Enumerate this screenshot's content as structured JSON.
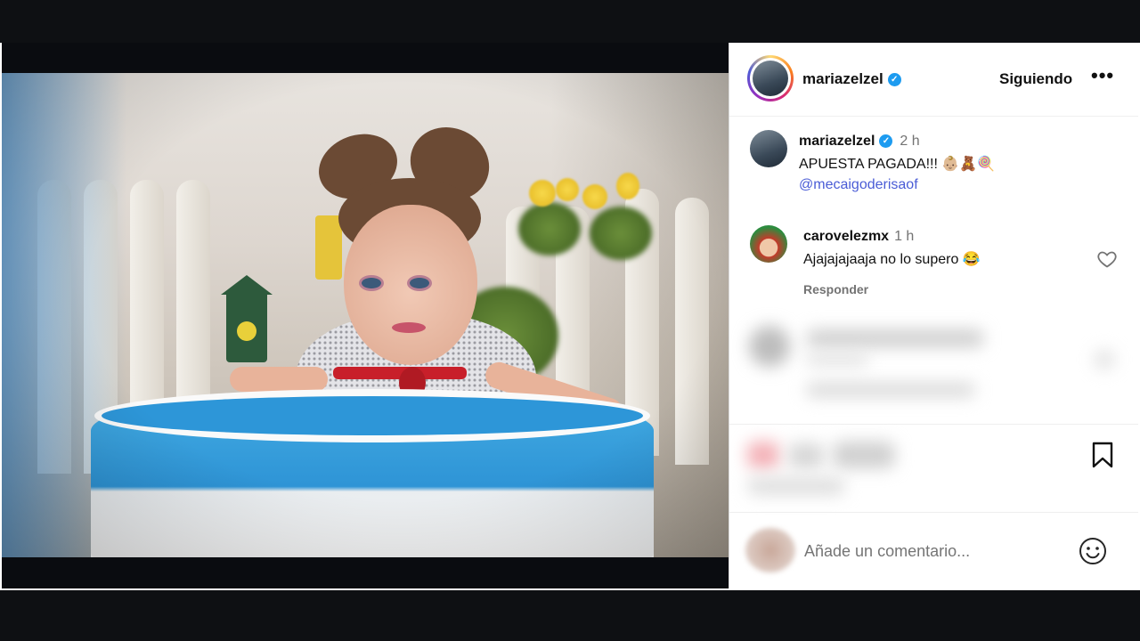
{
  "post": {
    "author": {
      "username": "mariazelzel",
      "verified": true,
      "follow_label": "Siguiendo",
      "more_icon": "ellipsis-icon",
      "more_label": "•••"
    },
    "caption": {
      "username": "mariazelzel",
      "time": "2 h",
      "text": "APUESTA PAGADA!!! 👶🏼🧸🍭",
      "mention": "@mecaigoderisaof"
    },
    "comments": [
      {
        "username": "carovelezmx",
        "time": "1 h",
        "text": "Ajajajajaaja no lo supero 😂",
        "reply_label": "Responder"
      }
    ],
    "add_comment": {
      "placeholder": "Añade un comentario...",
      "emoji_icon": "smiley-icon"
    },
    "icons": {
      "verified": "verified-badge-icon",
      "heart": "heart-icon",
      "bookmark": "bookmark-icon"
    },
    "colors": {
      "verified": "#1d9bf0",
      "mention": "#4a5cd6",
      "secondary_text": "#737373"
    }
  }
}
